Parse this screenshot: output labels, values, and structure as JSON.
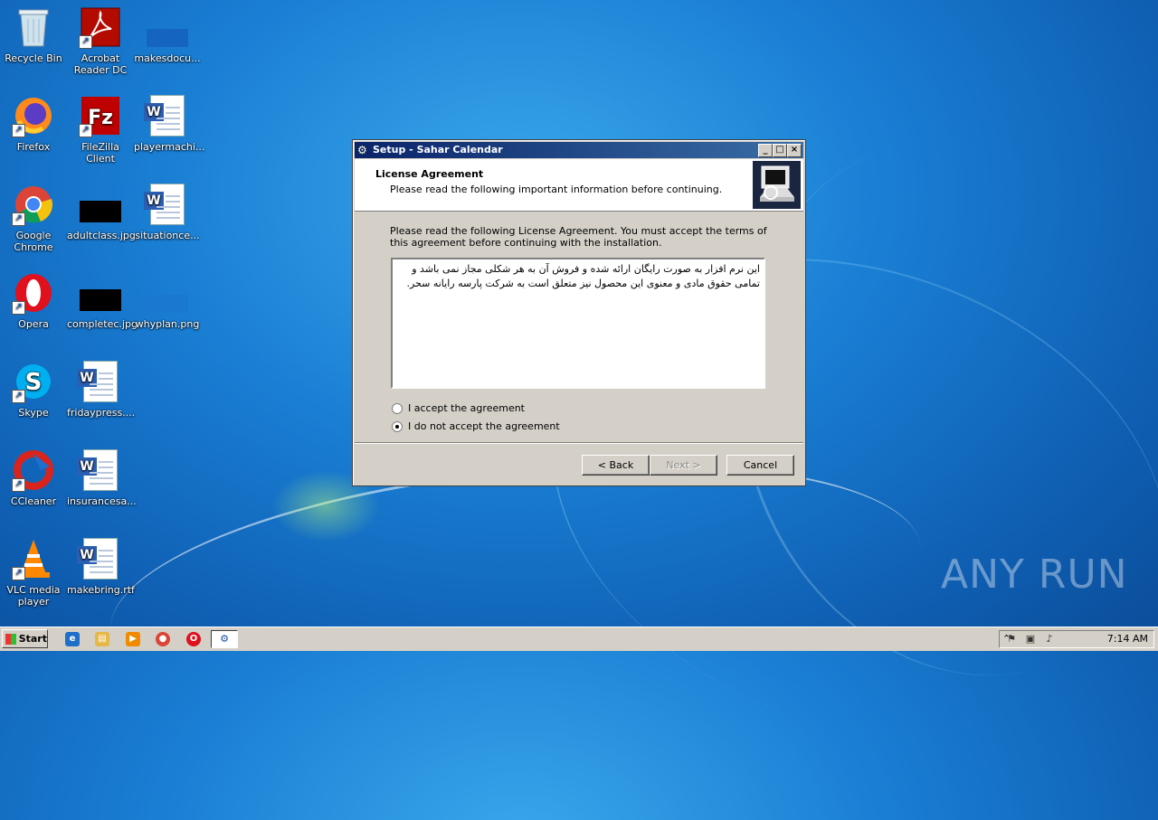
{
  "desktop": {
    "col1": [
      {
        "name": "recycle-bin",
        "label": "Recycle Bin",
        "icon": "recycle-bin-icon"
      },
      {
        "name": "firefox",
        "label": "Firefox",
        "icon": "firefox-icon"
      },
      {
        "name": "google-chrome",
        "label": "Google Chrome",
        "icon": "chrome-icon"
      },
      {
        "name": "opera",
        "label": "Opera",
        "icon": "opera-icon"
      },
      {
        "name": "skype",
        "label": "Skype",
        "icon": "skype-icon"
      },
      {
        "name": "ccleaner",
        "label": "CCleaner",
        "icon": "ccleaner-icon"
      },
      {
        "name": "vlc",
        "label": "VLC media player",
        "icon": "vlc-icon"
      }
    ],
    "col2": [
      {
        "label": "Acrobat Reader DC"
      },
      {
        "label": "FileZilla Client"
      },
      {
        "label": "adultclass.jpg"
      },
      {
        "label": "completec.jpg"
      },
      {
        "label": "fridaypress...."
      },
      {
        "label": "insurancesa..."
      },
      {
        "label": "makebring.rtf"
      }
    ],
    "col3": [
      {
        "label": "makesdocu..."
      },
      {
        "label": "playermachi..."
      },
      {
        "label": "situationce..."
      },
      {
        "label": "whyplan.png"
      }
    ]
  },
  "dialog": {
    "title": "Setup - Sahar Calendar",
    "header_title": "License Agreement",
    "header_subtitle": "Please read the following important information before continuing.",
    "instructions": "Please read the following License Agreement. You must accept the terms of this agreement before continuing with the installation.",
    "license_text": "این نرم افزار به صورت رایگان ارائه شده و فروش آن به هر شکلی مجاز نمی باشد و تمامی حقوق مادی و معنوی این محصول نیز متعلق است به شرکت پارسه رایانه سحر.",
    "accept_label": "I accept the agreement",
    "decline_label": "I do not accept the agreement",
    "selected": "decline",
    "back_label": "< Back",
    "next_label": "Next >",
    "cancel_label": "Cancel"
  },
  "taskbar": {
    "start_label": "Start",
    "clock": "7:14 AM"
  },
  "watermark": "ANY RUN"
}
